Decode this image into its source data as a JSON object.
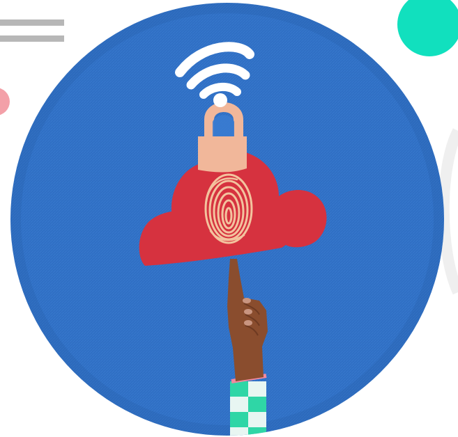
{
  "colors": {
    "page_background": "#ffffff",
    "circle_blue": "#2f6fc4",
    "cloud_red": "#d6323f",
    "lock_peach": "#f1b79a",
    "wifi_white": "#ffffff",
    "fingerprint": "#f3c39e",
    "accent_teal": "#11e0be",
    "accent_pink": "#f3a0a8",
    "stripe_grey": "#b7b7b7",
    "skin": "#8a4d2e",
    "sleeve_teal": "#2fd6a6",
    "sleeve_white": "#e8f6f2"
  },
  "icons": {
    "wifi": "wifi-icon",
    "lock": "padlock-icon",
    "fingerprint": "fingerprint-icon",
    "cloud": "cloud-icon"
  }
}
